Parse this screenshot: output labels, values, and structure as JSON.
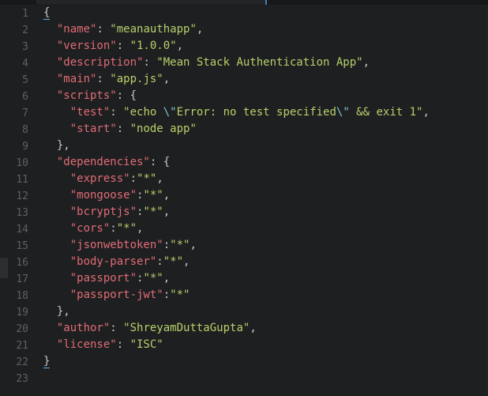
{
  "editor": {
    "line_numbers": [
      "1",
      "2",
      "3",
      "4",
      "5",
      "6",
      "7",
      "8",
      "9",
      "10",
      "11",
      "12",
      "13",
      "14",
      "15",
      "16",
      "17",
      "18",
      "19",
      "20",
      "21",
      "22",
      "23"
    ],
    "lines": [
      [
        {
          "t": "{",
          "c": "brace"
        }
      ],
      [
        {
          "t": "  ",
          "c": "punct"
        },
        {
          "t": "\"name\"",
          "c": "key"
        },
        {
          "t": ": ",
          "c": "punct"
        },
        {
          "t": "\"meanauthapp\"",
          "c": "str"
        },
        {
          "t": ",",
          "c": "punct"
        }
      ],
      [
        {
          "t": "  ",
          "c": "punct"
        },
        {
          "t": "\"version\"",
          "c": "key"
        },
        {
          "t": ": ",
          "c": "punct"
        },
        {
          "t": "\"1.0.0\"",
          "c": "str"
        },
        {
          "t": ",",
          "c": "punct"
        }
      ],
      [
        {
          "t": "  ",
          "c": "punct"
        },
        {
          "t": "\"description\"",
          "c": "key"
        },
        {
          "t": ": ",
          "c": "punct"
        },
        {
          "t": "\"Mean Stack Authentication App\"",
          "c": "str"
        },
        {
          "t": ",",
          "c": "punct"
        }
      ],
      [
        {
          "t": "  ",
          "c": "punct"
        },
        {
          "t": "\"main\"",
          "c": "key"
        },
        {
          "t": ": ",
          "c": "punct"
        },
        {
          "t": "\"app.js\"",
          "c": "str"
        },
        {
          "t": ",",
          "c": "punct"
        }
      ],
      [
        {
          "t": "  ",
          "c": "punct"
        },
        {
          "t": "\"scripts\"",
          "c": "key"
        },
        {
          "t": ": {",
          "c": "punct"
        }
      ],
      [
        {
          "t": "    ",
          "c": "punct"
        },
        {
          "t": "\"test\"",
          "c": "key"
        },
        {
          "t": ": ",
          "c": "punct"
        },
        {
          "t": "\"echo ",
          "c": "str"
        },
        {
          "t": "\\\"",
          "c": "esc"
        },
        {
          "t": "Error: no test specified",
          "c": "str"
        },
        {
          "t": "\\\"",
          "c": "esc"
        },
        {
          "t": " && exit 1\"",
          "c": "str"
        },
        {
          "t": ",",
          "c": "punct"
        }
      ],
      [
        {
          "t": "    ",
          "c": "punct"
        },
        {
          "t": "\"start\"",
          "c": "key"
        },
        {
          "t": ": ",
          "c": "punct"
        },
        {
          "t": "\"node app\"",
          "c": "str"
        }
      ],
      [
        {
          "t": "  },",
          "c": "punct"
        }
      ],
      [
        {
          "t": "  ",
          "c": "punct"
        },
        {
          "t": "\"dependencies\"",
          "c": "key"
        },
        {
          "t": ": {",
          "c": "punct"
        }
      ],
      [
        {
          "t": "    ",
          "c": "punct"
        },
        {
          "t": "\"express\"",
          "c": "key"
        },
        {
          "t": ":",
          "c": "punct"
        },
        {
          "t": "\"*\"",
          "c": "str"
        },
        {
          "t": ",",
          "c": "punct"
        }
      ],
      [
        {
          "t": "    ",
          "c": "punct"
        },
        {
          "t": "\"mongoose\"",
          "c": "key"
        },
        {
          "t": ":",
          "c": "punct"
        },
        {
          "t": "\"*\"",
          "c": "str"
        },
        {
          "t": ",",
          "c": "punct"
        }
      ],
      [
        {
          "t": "    ",
          "c": "punct"
        },
        {
          "t": "\"bcryptjs\"",
          "c": "key"
        },
        {
          "t": ":",
          "c": "punct"
        },
        {
          "t": "\"*\"",
          "c": "str"
        },
        {
          "t": ",",
          "c": "punct"
        }
      ],
      [
        {
          "t": "    ",
          "c": "punct"
        },
        {
          "t": "\"cors\"",
          "c": "key"
        },
        {
          "t": ":",
          "c": "punct"
        },
        {
          "t": "\"*\"",
          "c": "str"
        },
        {
          "t": ",",
          "c": "punct"
        }
      ],
      [
        {
          "t": "    ",
          "c": "punct"
        },
        {
          "t": "\"jsonwebtoken\"",
          "c": "key"
        },
        {
          "t": ":",
          "c": "punct"
        },
        {
          "t": "\"*\"",
          "c": "str"
        },
        {
          "t": ",",
          "c": "punct"
        }
      ],
      [
        {
          "t": "    ",
          "c": "punct"
        },
        {
          "t": "\"body-parser\"",
          "c": "key"
        },
        {
          "t": ":",
          "c": "punct"
        },
        {
          "t": "\"*\"",
          "c": "str"
        },
        {
          "t": ",",
          "c": "punct"
        }
      ],
      [
        {
          "t": "    ",
          "c": "punct"
        },
        {
          "t": "\"passport\"",
          "c": "key"
        },
        {
          "t": ":",
          "c": "punct"
        },
        {
          "t": "\"*\"",
          "c": "str"
        },
        {
          "t": ",",
          "c": "punct"
        }
      ],
      [
        {
          "t": "    ",
          "c": "punct"
        },
        {
          "t": "\"passport-jwt\"",
          "c": "key"
        },
        {
          "t": ":",
          "c": "punct"
        },
        {
          "t": "\"*\"",
          "c": "str"
        }
      ],
      [
        {
          "t": "  },",
          "c": "punct"
        }
      ],
      [
        {
          "t": "  ",
          "c": "punct"
        },
        {
          "t": "\"author\"",
          "c": "key"
        },
        {
          "t": ": ",
          "c": "punct"
        },
        {
          "t": "\"ShreyamDuttaGupta\"",
          "c": "str"
        },
        {
          "t": ",",
          "c": "punct"
        }
      ],
      [
        {
          "t": "  ",
          "c": "punct"
        },
        {
          "t": "\"license\"",
          "c": "key"
        },
        {
          "t": ": ",
          "c": "punct"
        },
        {
          "t": "\"ISC\"",
          "c": "str"
        }
      ],
      [
        {
          "t": "}",
          "c": "brace"
        }
      ],
      []
    ]
  },
  "colors": {
    "background": "#1e1f21",
    "key": "#e06c75",
    "string": "#b5d16a",
    "escape": "#7ec6d6",
    "punctuation": "#c5c8c6",
    "line_number": "#5c6166",
    "accent": "#4d7bb8"
  }
}
